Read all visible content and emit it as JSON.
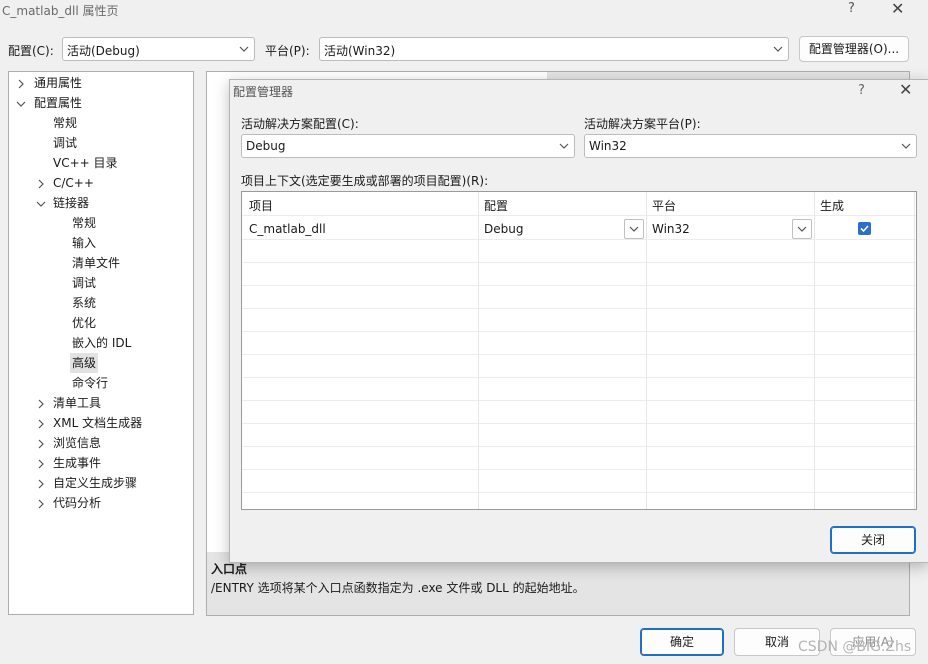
{
  "window": {
    "title": "C_matlab_dll 属性页",
    "help": "?",
    "close": "✕"
  },
  "topbar": {
    "config_label": "配置(C):",
    "config_value": "活动(Debug)",
    "platform_label": "平台(P):",
    "platform_value": "活动(Win32)",
    "manager_button": "配置管理器(O)..."
  },
  "tree": {
    "items": [
      {
        "label": "通用属性"
      },
      {
        "label": "配置属性"
      },
      {
        "label": "常规"
      },
      {
        "label": "调试"
      },
      {
        "label": "VC++ 目录"
      },
      {
        "label": "C/C++"
      },
      {
        "label": "链接器"
      },
      {
        "label": "常规"
      },
      {
        "label": "输入"
      },
      {
        "label": "清单文件"
      },
      {
        "label": "调试"
      },
      {
        "label": "系统"
      },
      {
        "label": "优化"
      },
      {
        "label": "嵌入的 IDL"
      },
      {
        "label": "高级"
      },
      {
        "label": "命令行"
      },
      {
        "label": "清单工具"
      },
      {
        "label": "XML 文档生成器"
      },
      {
        "label": "浏览信息"
      },
      {
        "label": "生成事件"
      },
      {
        "label": "自定义生成步骤"
      },
      {
        "label": "代码分析"
      }
    ]
  },
  "description": {
    "title": "入口点",
    "text": "/ENTRY 选项将某个入口点函数指定为 .exe 文件或 DLL 的起始地址。"
  },
  "dialog": {
    "title": "配置管理器",
    "help": "?",
    "close": "✕",
    "solution_config_label": "活动解决方案配置(C):",
    "solution_config_value": "Debug",
    "solution_platform_label": "活动解决方案平台(P):",
    "solution_platform_value": "Win32",
    "contexts_label": "项目上下文(选定要生成或部署的项目配置)(R):",
    "columns": [
      "项目",
      "配置",
      "平台",
      "生成"
    ],
    "rows": [
      {
        "project": "C_matlab_dll",
        "config": "Debug",
        "platform": "Win32",
        "build": true
      }
    ],
    "close_button": "关闭"
  },
  "footer": {
    "ok": "确定",
    "cancel": "取消",
    "apply": "应用(A)"
  },
  "watermark": "CSDN @BIG.Zhs",
  "colors": {
    "accent": "#1f6fc5",
    "checkbox": "#2a6fcf",
    "selection": "#e2e2e2"
  }
}
